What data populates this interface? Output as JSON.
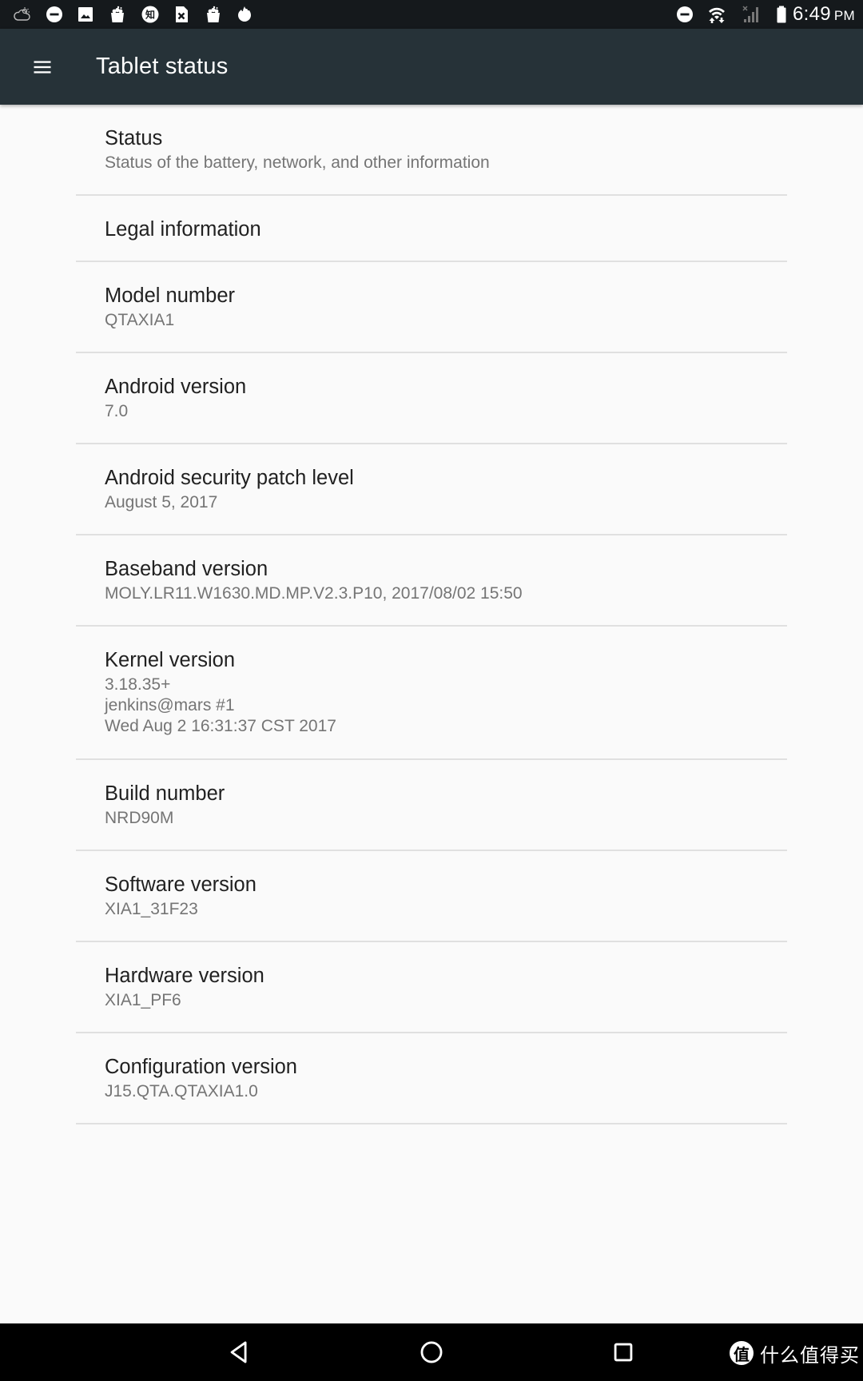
{
  "status_bar": {
    "left_icons": [
      {
        "name": "weather-cloud-icon"
      },
      {
        "name": "do-not-disturb-icon"
      },
      {
        "name": "image-icon"
      },
      {
        "name": "shopping-bag-icon"
      },
      {
        "name": "zhihu-icon",
        "glyph": "知"
      },
      {
        "name": "sim-error-icon"
      },
      {
        "name": "shopping-bag-icon"
      },
      {
        "name": "flame-icon"
      }
    ],
    "right_icons": [
      {
        "name": "do-not-disturb-icon"
      },
      {
        "name": "wifi-icon"
      },
      {
        "name": "cell-signal-no-service-icon"
      },
      {
        "name": "battery-icon"
      }
    ],
    "time": "6:49",
    "ampm": "PM"
  },
  "toolbar": {
    "menu_icon": "hamburger-menu-icon",
    "title": "Tablet status"
  },
  "preferences": [
    {
      "id": "status",
      "title": "Status",
      "summary": "Status of the battery, network, and other information"
    },
    {
      "id": "legal",
      "title": "Legal information",
      "summary": null
    },
    {
      "id": "model",
      "title": "Model number",
      "summary": "QTAXIA1"
    },
    {
      "id": "android-version",
      "title": "Android version",
      "summary": "7.0"
    },
    {
      "id": "security-patch",
      "title": "Android security patch level",
      "summary": "August 5, 2017"
    },
    {
      "id": "baseband",
      "title": "Baseband version",
      "summary": "MOLY.LR11.W1630.MD.MP.V2.3.P10, 2017/08/02 15:50"
    },
    {
      "id": "kernel",
      "title": "Kernel version",
      "summary": "3.18.35+\njenkins@mars #1\nWed Aug 2 16:31:37 CST 2017"
    },
    {
      "id": "build",
      "title": "Build number",
      "summary": "NRD90M"
    },
    {
      "id": "software",
      "title": "Software version",
      "summary": "XIA1_31F23"
    },
    {
      "id": "hardware",
      "title": "Hardware version",
      "summary": "XIA1_PF6"
    },
    {
      "id": "configuration",
      "title": "Configuration version",
      "summary": "J15.QTA.QTAXIA1.0"
    }
  ],
  "nav_bar": {
    "buttons": [
      {
        "name": "back-button",
        "icon": "back-triangle-icon"
      },
      {
        "name": "home-button",
        "icon": "home-circle-icon"
      },
      {
        "name": "recents-button",
        "icon": "recents-square-icon"
      }
    ],
    "watermark": {
      "badge": "值",
      "text": "什么值得买"
    }
  },
  "colors": {
    "status_bar": "#15191c",
    "toolbar": "#263238",
    "background": "#fafafa",
    "title_text": "#212121",
    "summary_text": "#757575",
    "divider": "#e0e0e0",
    "nav_bar": "#000000"
  }
}
